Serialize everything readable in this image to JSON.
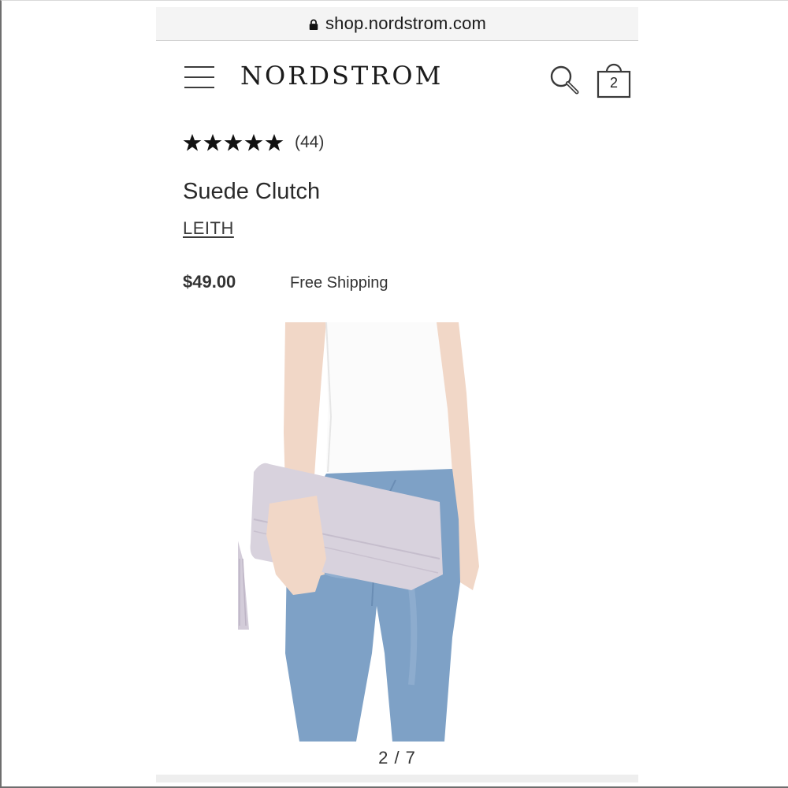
{
  "browser": {
    "url": "shop.nordstrom.com",
    "lock_icon": "lock-icon"
  },
  "header": {
    "menu_icon": "hamburger-menu-icon",
    "logo_text": "NORDSTROM",
    "search_icon": "search-icon",
    "bag_icon": "shopping-bag-icon",
    "bag_count": "2"
  },
  "product": {
    "rating_stars": 5,
    "review_count": "(44)",
    "title": "Suede Clutch",
    "brand": "LEITH",
    "price": "$49.00",
    "shipping": "Free Shipping"
  },
  "gallery": {
    "pager": "2 / 7"
  },
  "colors": {
    "text": "#333333",
    "star": "#111111",
    "clutch": "#d8d2dd",
    "denim": "#7ea1c6",
    "skin": "#f1d7c7"
  }
}
